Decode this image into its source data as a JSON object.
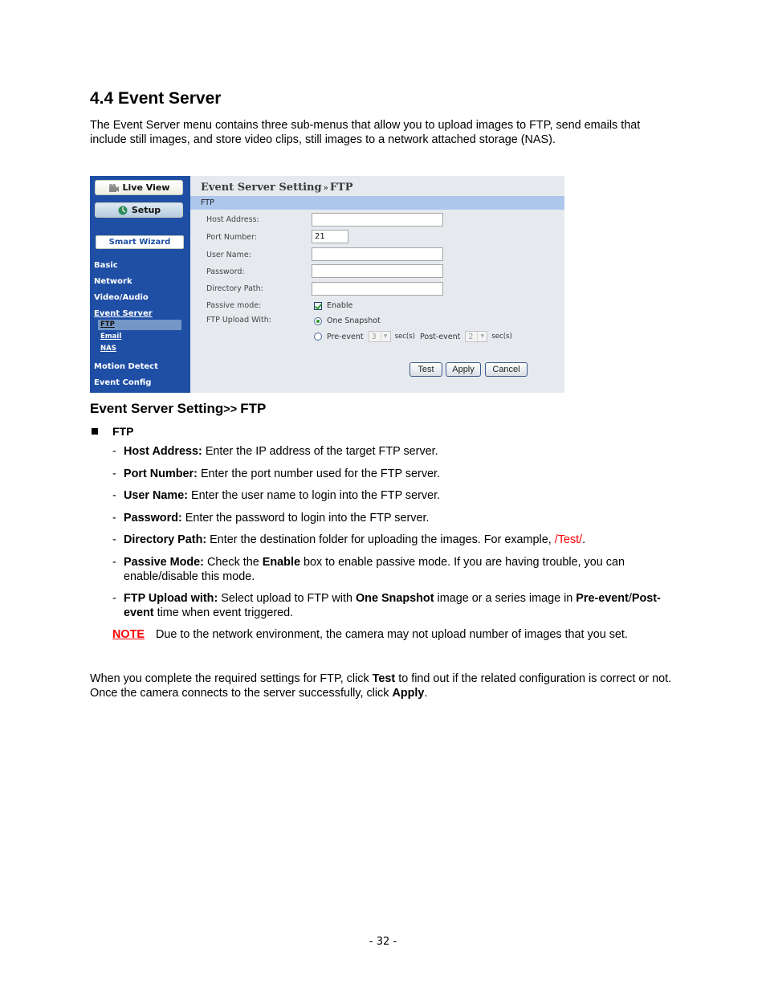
{
  "section": {
    "title": "4.4  Event Server",
    "intro": "The Event Server menu contains three sub-menus that allow you to upload images to FTP, send emails that include still images, and store video clips, still images to a network attached storage (NAS)."
  },
  "ui": {
    "sidebar": {
      "live_view": "Live View",
      "setup": "Setup",
      "smart_wizard": "Smart Wizard",
      "nav": [
        "Basic",
        "Network",
        "Video/Audio",
        "Event Server",
        "Motion Detect",
        "Event Config"
      ],
      "subnav": [
        "FTP",
        "Email",
        "NAS"
      ],
      "active_nav": "Event Server",
      "active_subnav": "FTP"
    },
    "title_main": "Event Server Setting",
    "title_sep": "»",
    "title_sub": "FTP",
    "band": "FTP",
    "fields": {
      "host_address": {
        "label": "Host Address:",
        "value": ""
      },
      "port_number": {
        "label": "Port Number:",
        "value": "21"
      },
      "user_name": {
        "label": "User Name:",
        "value": ""
      },
      "password": {
        "label": "Password:",
        "value": ""
      },
      "directory_path": {
        "label": "Directory Path:",
        "value": ""
      }
    },
    "passive_mode": {
      "label": "Passive mode:",
      "option": "Enable",
      "checked": true
    },
    "upload_with": {
      "label": "FTP Upload With:",
      "one_snapshot": "One Snapshot",
      "pre_event": "Pre-event",
      "pre_event_value": "3",
      "post_event": "Post-event",
      "post_event_value": "2",
      "unit": "sec(s)",
      "selected": "One Snapshot"
    },
    "buttons": {
      "test": "Test",
      "apply": "Apply",
      "cancel": "Cancel"
    },
    "colors": {
      "sidebar": "#1f4fa5",
      "band": "#adc6ec",
      "panel": "#e6eaee"
    }
  },
  "doc": {
    "heading_main": "Event Server Setting",
    "heading_sep": ">> ",
    "heading_sub": "FTP",
    "bullet": "FTP",
    "items": [
      {
        "term": "Host Address:",
        "text": " Enter the IP address of the target FTP server."
      },
      {
        "term": "Port Number:",
        "text": " Enter the port number used for the FTP server."
      },
      {
        "term": "User Name:",
        "text": " Enter the user name to login into the FTP server."
      },
      {
        "term": "Password:",
        "text": " Enter the password to login into the FTP server."
      },
      {
        "term": "Directory Path:",
        "text": " Enter the destination folder for uploading the images. For example, ",
        "example": "/Test/",
        "after": "."
      },
      {
        "term": "Passive Mode:",
        "text1": " Check the ",
        "bold1": "Enable",
        "text2": " box to enable passive mode.  If you are having trouble, you can enable/disable this mode."
      },
      {
        "term": "FTP Upload with:",
        "text1": " Select upload to FTP with ",
        "bold1": "One Snapshot",
        "text2": " image or a series image in ",
        "bold2": "Pre-event",
        "text3": "/",
        "bold3": "Post-event",
        "text4": " time when event triggered."
      }
    ],
    "note_tag": "NOTE",
    "note_text": "Due to the network environment, the camera may not upload number of images that you set.",
    "closing": {
      "t1": "When you complete the required settings for FTP, click ",
      "b1": "Test",
      "t2": " to find out if the related configuration is correct or not. Once the camera connects to the server successfully, click ",
      "b2": "Apply",
      "t3": "."
    },
    "dash": "-"
  },
  "page_number": "- 32 -"
}
